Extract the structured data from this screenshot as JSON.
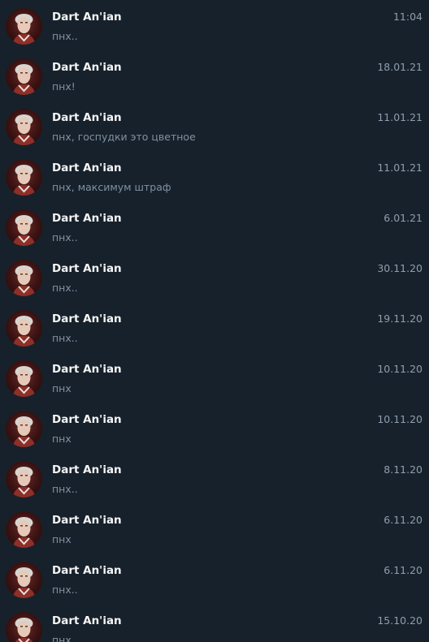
{
  "dialogs": [
    {
      "name": "Dart An'ian",
      "preview": "пнх..",
      "time": "11:04"
    },
    {
      "name": "Dart An'ian",
      "preview": "пнх!",
      "time": "18.01.21"
    },
    {
      "name": "Dart An'ian",
      "preview": "пнх, госпудки это цветное",
      "time": "11.01.21"
    },
    {
      "name": "Dart An'ian",
      "preview": "пнх, максимум штраф",
      "time": "11.01.21"
    },
    {
      "name": "Dart An'ian",
      "preview": "пнх..",
      "time": "6.01.21"
    },
    {
      "name": "Dart An'ian",
      "preview": "пнх..",
      "time": "30.11.20"
    },
    {
      "name": "Dart An'ian",
      "preview": "пнх..",
      "time": "19.11.20"
    },
    {
      "name": "Dart An'ian",
      "preview": "пнх",
      "time": "10.11.20"
    },
    {
      "name": "Dart An'ian",
      "preview": "пнх",
      "time": "10.11.20"
    },
    {
      "name": "Dart An'ian",
      "preview": "пнх..",
      "time": "8.11.20"
    },
    {
      "name": "Dart An'ian",
      "preview": "пнх",
      "time": "6.11.20"
    },
    {
      "name": "Dart An'ian",
      "preview": "пнх..",
      "time": "6.11.20"
    },
    {
      "name": "Dart An'ian",
      "preview": "пнх",
      "time": "15.10.20"
    }
  ]
}
